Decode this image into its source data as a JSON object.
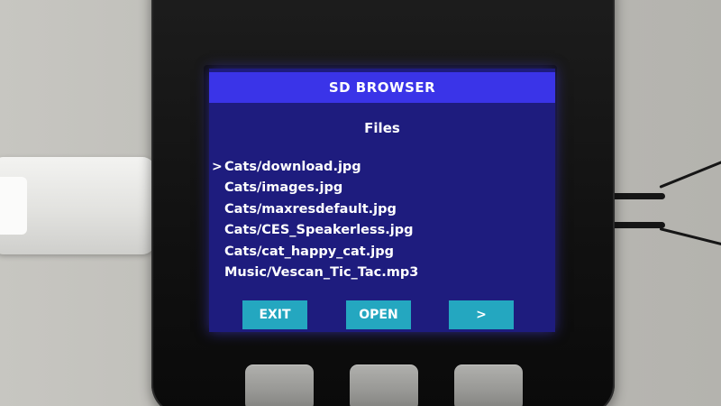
{
  "screen": {
    "title": "SD BROWSER",
    "section_title": "Files",
    "selected_marker": ">",
    "files": [
      "Cats/download.jpg",
      "Cats/images.jpg",
      "Cats/maxresdefault.jpg",
      "Cats/CES_Speakerless.jpg",
      "Cats/cat_happy_cat.jpg",
      "Music/Vescan_Tic_Tac.mp3"
    ],
    "selected_index": 0,
    "buttons": {
      "left": "EXIT",
      "center": "OPEN",
      "right": ">"
    }
  },
  "colors": {
    "screen_bg": "#1e1c7e",
    "titlebar_bg": "#3a34e8",
    "button_bg": "#24a7c0",
    "text": "#ffffff"
  }
}
